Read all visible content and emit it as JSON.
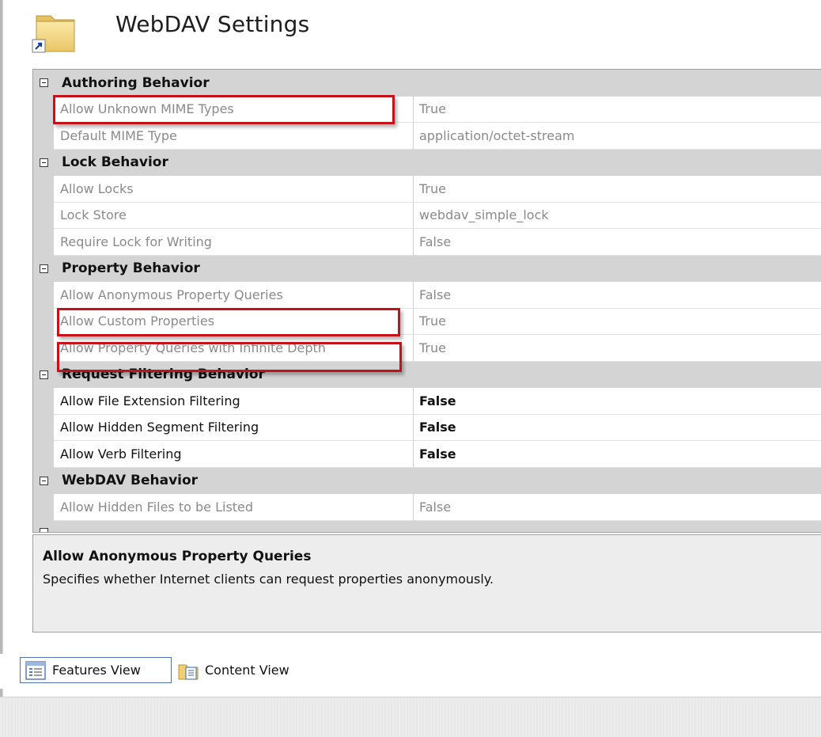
{
  "header": {
    "title": "WebDAV Settings",
    "icon": "folder-shortcut-icon"
  },
  "grid": {
    "categories": [
      {
        "label": "Authoring Behavior",
        "rows": [
          {
            "name": "Allow Unknown MIME Types",
            "value": "True"
          },
          {
            "name": "Default MIME Type",
            "value": "application/octet-stream"
          }
        ]
      },
      {
        "label": "Lock Behavior",
        "rows": [
          {
            "name": "Allow Locks",
            "value": "True"
          },
          {
            "name": "Lock Store",
            "value": "webdav_simple_lock"
          },
          {
            "name": "Require Lock for Writing",
            "value": "False"
          }
        ]
      },
      {
        "label": "Property Behavior",
        "rows": [
          {
            "name": "Allow Anonymous Property Queries",
            "value": "False"
          },
          {
            "name": "Allow Custom Properties",
            "value": "True"
          },
          {
            "name": "Allow Property Queries with Infinite Depth",
            "value": "True"
          }
        ]
      },
      {
        "label": "Request Filtering Behavior",
        "rows": [
          {
            "name": "Allow File Extension Filtering",
            "value": "False"
          },
          {
            "name": "Allow Hidden Segment Filtering",
            "value": "False"
          },
          {
            "name": "Allow Verb Filtering",
            "value": "False"
          }
        ]
      },
      {
        "label": "WebDAV Behavior",
        "rows": [
          {
            "name": "Allow Hidden Files to be Listed",
            "value": "False"
          }
        ]
      }
    ]
  },
  "description": {
    "title": "Allow Anonymous Property Queries",
    "text": "Specifies whether Internet clients can request properties anonymously."
  },
  "view_tabs": {
    "features": "Features View",
    "content": "Content View"
  },
  "colors": {
    "highlight": "#c4121a",
    "category_bg": "#d4d4d4",
    "inactive_text": "#8a8a8a"
  }
}
